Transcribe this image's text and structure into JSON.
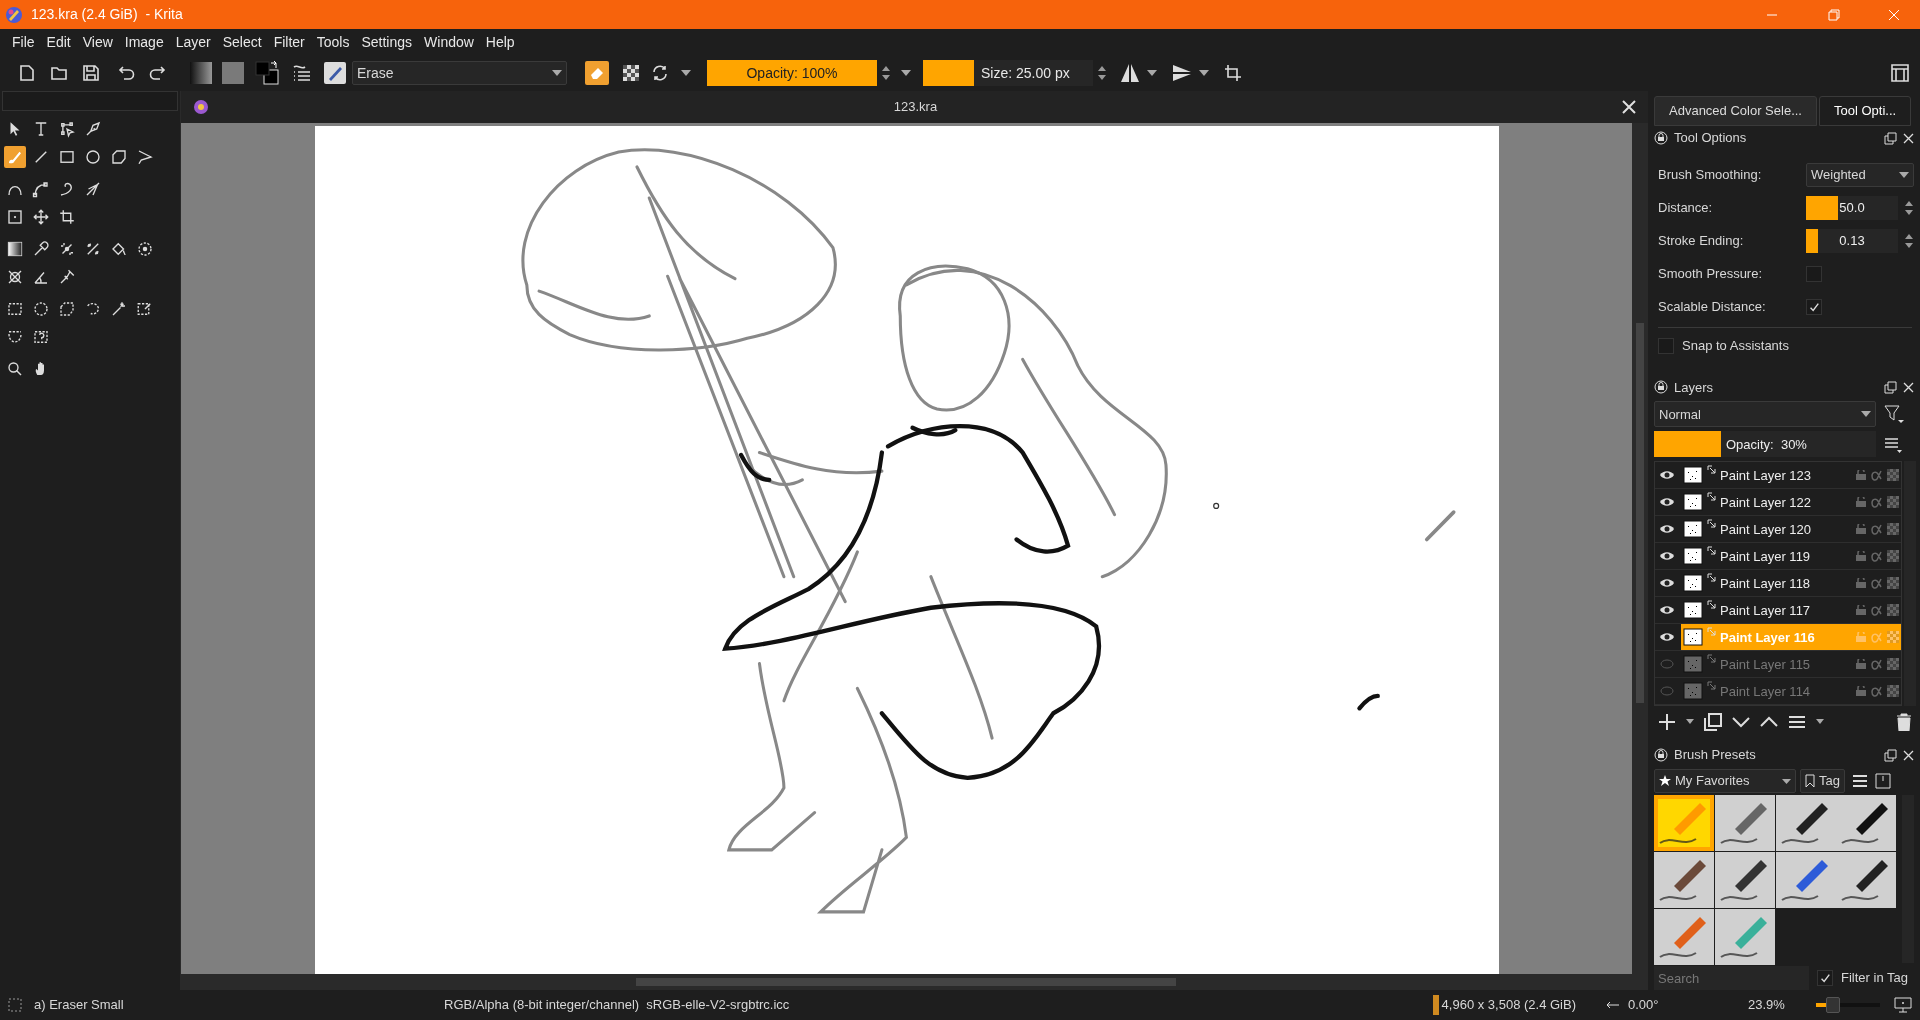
{
  "title_bar": {
    "title": "123.kra (2.4 GiB)  - Krita"
  },
  "menu": [
    "File",
    "Edit",
    "View",
    "Image",
    "Layer",
    "Select",
    "Filter",
    "Tools",
    "Settings",
    "Window",
    "Help"
  ],
  "toolbar": {
    "brush_name": "Erase",
    "eraser_mode": {
      "on": true
    },
    "opacity": {
      "label": "Opacity: 100%",
      "level": 1
    },
    "size": {
      "label": "Size: 25.00 px",
      "level": 0.3
    }
  },
  "document_tab": {
    "title": "123.kra"
  },
  "toolbox": [
    [
      {
        "kind": "pointer",
        "selected": false
      },
      {
        "kind": "text",
        "selected": false
      },
      {
        "kind": "editshapes",
        "selected": false
      },
      {
        "kind": "calligraphy",
        "selected": false
      }
    ],
    [
      {
        "kind": "brush",
        "selected": true
      },
      {
        "kind": "line",
        "selected": false
      },
      {
        "kind": "rectangle",
        "selected": false
      },
      {
        "kind": "ellipse",
        "selected": false
      },
      {
        "kind": "polygon",
        "selected": false
      },
      {
        "kind": "polyline",
        "selected": false
      }
    ],
    [
      {
        "kind": "bezier",
        "selected": false
      },
      {
        "kind": "path",
        "selected": false
      },
      {
        "kind": "freehand",
        "selected": false
      },
      {
        "kind": "multibrush",
        "selected": false
      }
    ],
    [
      {
        "kind": "transform",
        "selected": false
      },
      {
        "kind": "move",
        "selected": false
      },
      {
        "kind": "crop",
        "selected": false
      }
    ],
    [
      {
        "kind": "gradient",
        "selected": false
      },
      {
        "kind": "picker",
        "selected": false
      },
      {
        "kind": "colorize",
        "selected": false
      },
      {
        "kind": "patch",
        "selected": false
      },
      {
        "kind": "fill",
        "selected": false
      },
      {
        "kind": "enclose",
        "selected": false
      }
    ],
    [
      {
        "kind": "assistant",
        "selected": false
      },
      {
        "kind": "measure",
        "selected": false
      },
      {
        "kind": "reference",
        "selected": false
      }
    ],
    [
      {
        "kind": "rectselect",
        "selected": false
      },
      {
        "kind": "ellipseselect",
        "selected": false
      },
      {
        "kind": "polyselect",
        "selected": false
      },
      {
        "kind": "freeselect",
        "selected": false
      },
      {
        "kind": "wand",
        "selected": false
      },
      {
        "kind": "colorselect",
        "selected": false
      }
    ],
    [
      {
        "kind": "bezierselect",
        "selected": false
      },
      {
        "kind": "magneticselect",
        "selected": false
      }
    ],
    [
      {
        "kind": "zoom",
        "selected": false
      },
      {
        "kind": "pan",
        "selected": false
      }
    ]
  ],
  "docker_tabs": [
    {
      "label": "Advanced Color Sele...",
      "selected": false
    },
    {
      "label": "Tool Opti...",
      "selected": true
    }
  ],
  "tool_options": {
    "title": "Tool Options",
    "rows": [
      {
        "kind": "select",
        "label": "Brush Smoothing:",
        "value": "Weighted"
      },
      {
        "kind": "slider",
        "label": "Distance:",
        "value": "50.0",
        "level": 0.35
      },
      {
        "kind": "slider",
        "label": "Stroke Ending:",
        "value": "0.13",
        "level": 0.13
      },
      {
        "kind": "checkbox",
        "label": "Smooth Pressure:",
        "checked": false
      },
      {
        "kind": "checkbox",
        "label": "Scalable Distance:",
        "checked": true
      }
    ],
    "snap": {
      "label": "Snap to Assistants",
      "checked": false
    }
  },
  "layers": {
    "title": "Layers",
    "blend_mode": "Normal",
    "opacity": {
      "label": "Opacity:  30%",
      "level": 0.3
    },
    "items": [
      {
        "name": "Paint Layer 123",
        "visible": true,
        "selected": false
      },
      {
        "name": "Paint Layer 122",
        "visible": true,
        "selected": false
      },
      {
        "name": "Paint Layer 120",
        "visible": true,
        "selected": false
      },
      {
        "name": "Paint Layer 119",
        "visible": true,
        "selected": false
      },
      {
        "name": "Paint Layer 118",
        "visible": true,
        "selected": false
      },
      {
        "name": "Paint Layer 117",
        "visible": true,
        "selected": false
      },
      {
        "name": "Paint Layer 116",
        "visible": true,
        "selected": true
      },
      {
        "name": "Paint Layer 115",
        "visible": false,
        "selected": false
      },
      {
        "name": "Paint Layer 114",
        "visible": false,
        "selected": false
      }
    ]
  },
  "brush_presets": {
    "title": "Brush Presets",
    "tag": "My Favorites",
    "tag_button": "Tag",
    "items": [
      {
        "kind": "eraser",
        "selected": true
      },
      {
        "kind": "blur",
        "selected": false
      },
      {
        "kind": "airbrush",
        "selected": false
      },
      {
        "kind": "marker",
        "selected": false
      },
      {
        "kind": "paintbrush",
        "selected": false
      },
      {
        "kind": "pencil",
        "selected": false
      },
      {
        "kind": "pen",
        "selected": false
      },
      {
        "kind": "inkpen",
        "selected": false
      },
      {
        "kind": "oilbrush",
        "selected": false
      },
      {
        "kind": "watercolor",
        "selected": false
      }
    ],
    "search": {
      "placeholder": "Search"
    },
    "filter_in_tag": {
      "label": "Filter in Tag",
      "checked": true
    }
  },
  "status_bar": {
    "preset": "a) Eraser Small",
    "color_space": "RGB/Alpha (8-bit integer/channel)  sRGB-elle-V2-srgbtrc.icc",
    "dimensions": "4,960 x 3,508 (2.4 GiB)",
    "rotation": "0.00°",
    "zoom": "23.9%",
    "zoom_slider": {
      "level": 0.2
    }
  }
}
